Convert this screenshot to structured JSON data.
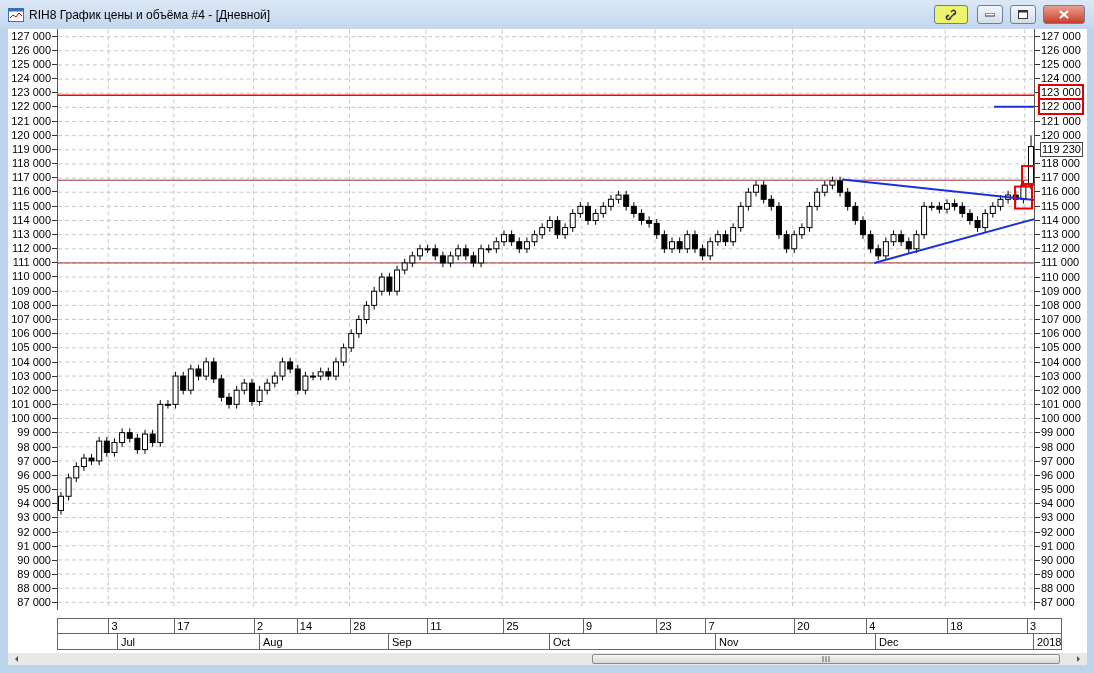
{
  "window": {
    "title": "RIH8 График цены и объёма #4 - [Дневной]"
  },
  "title_buttons": [
    {
      "kind": "link"
    },
    {
      "kind": "minimize"
    },
    {
      "kind": "maximize"
    },
    {
      "kind": "close"
    }
  ],
  "price_axis_right": {
    "labels": [
      {
        "text": "127 000",
        "kind": "tick"
      },
      {
        "text": "126 000",
        "kind": "tick"
      },
      {
        "text": "125 000",
        "kind": "tick"
      },
      {
        "text": "124 000",
        "kind": "tick"
      },
      {
        "text": "123 000",
        "kind": "marked"
      },
      {
        "text": "122 000",
        "kind": "marked"
      },
      {
        "text": "121 000",
        "kind": "tick"
      },
      {
        "text": "120 000",
        "kind": "tick"
      },
      {
        "text": "119 230",
        "kind": "last"
      },
      {
        "text": "118 000",
        "kind": "tick"
      },
      {
        "text": "117 000",
        "kind": "tick"
      },
      {
        "text": "116 000",
        "kind": "tick"
      },
      {
        "text": "115 000",
        "kind": "tick"
      },
      {
        "text": "114 000",
        "kind": "tick"
      },
      {
        "text": "113 000",
        "kind": "tick"
      },
      {
        "text": "112 000",
        "kind": "tick"
      },
      {
        "text": "111 000",
        "kind": "tick"
      },
      {
        "text": "110 000",
        "kind": "tick"
      },
      {
        "text": "109 000",
        "kind": "tick"
      },
      {
        "text": "108 000",
        "kind": "tick"
      },
      {
        "text": "107 000",
        "kind": "tick"
      },
      {
        "text": "106 000",
        "kind": "tick"
      },
      {
        "text": "105 000",
        "kind": "tick"
      },
      {
        "text": "104 000",
        "kind": "tick"
      },
      {
        "text": "103 000",
        "kind": "tick"
      },
      {
        "text": "102 000",
        "kind": "tick"
      },
      {
        "text": "101 000",
        "kind": "tick"
      },
      {
        "text": "100 000",
        "kind": "tick"
      },
      {
        "text": "99 000",
        "kind": "tick"
      },
      {
        "text": "98 000",
        "kind": "tick"
      },
      {
        "text": "97 000",
        "kind": "tick"
      },
      {
        "text": "96 000",
        "kind": "tick"
      },
      {
        "text": "95 000",
        "kind": "tick"
      },
      {
        "text": "94 000",
        "kind": "tick"
      },
      {
        "text": "93 000",
        "kind": "tick"
      },
      {
        "text": "92 000",
        "kind": "tick"
      },
      {
        "text": "91 000",
        "kind": "tick"
      },
      {
        "text": "90 000",
        "kind": "tick"
      },
      {
        "text": "89 000",
        "kind": "tick"
      },
      {
        "text": "88 000",
        "kind": "tick"
      },
      {
        "text": "87 000",
        "kind": "tick"
      }
    ]
  },
  "chart_data": {
    "type": "candlestick",
    "ylim": [
      86500,
      127500
    ],
    "grid": true,
    "ref_lines": [
      {
        "axis": "y",
        "value": 122850,
        "color": "#ff0000"
      },
      {
        "axis": "y",
        "value": 116850,
        "color": "#a03030"
      },
      {
        "axis": "y",
        "value": 111000,
        "color": "#a03030"
      }
    ],
    "yticks": [
      {
        "value": 127000,
        "label": "127 000"
      },
      {
        "value": 126000,
        "label": "126 000"
      },
      {
        "value": 125000,
        "label": "125 000"
      },
      {
        "value": 124000,
        "label": "124 000"
      },
      {
        "value": 123000,
        "label": "123 000"
      },
      {
        "value": 122000,
        "label": "122 000"
      },
      {
        "value": 121000,
        "label": "121 000"
      },
      {
        "value": 120000,
        "label": "120 000"
      },
      {
        "value": 119000,
        "label": "119 000"
      },
      {
        "value": 118000,
        "label": "118 000"
      },
      {
        "value": 117000,
        "label": "117 000"
      },
      {
        "value": 116000,
        "label": "116 000"
      },
      {
        "value": 115000,
        "label": "115 000"
      },
      {
        "value": 114000,
        "label": "114 000"
      },
      {
        "value": 113000,
        "label": "113 000"
      },
      {
        "value": 112000,
        "label": "112 000"
      },
      {
        "value": 111000,
        "label": "111 000"
      },
      {
        "value": 110000,
        "label": "110 000"
      },
      {
        "value": 109000,
        "label": "109 000"
      },
      {
        "value": 108000,
        "label": "108 000"
      },
      {
        "value": 107000,
        "label": "107 000"
      },
      {
        "value": 106000,
        "label": "106 000"
      },
      {
        "value": 105000,
        "label": "105 000"
      },
      {
        "value": 104000,
        "label": "104 000"
      },
      {
        "value": 103000,
        "label": "103 000"
      },
      {
        "value": 102000,
        "label": "102 000"
      },
      {
        "value": 101000,
        "label": "101 000"
      },
      {
        "value": 100000,
        "label": "100 000"
      },
      {
        "value": 99000,
        "label": "99 000"
      },
      {
        "value": 98000,
        "label": "98 000"
      },
      {
        "value": 97000,
        "label": "97 000"
      },
      {
        "value": 96000,
        "label": "96 000"
      },
      {
        "value": 95000,
        "label": "95 000"
      },
      {
        "value": 94000,
        "label": "94 000"
      },
      {
        "value": 93000,
        "label": "93 000"
      },
      {
        "value": 92000,
        "label": "92 000"
      },
      {
        "value": 91000,
        "label": "91 000"
      },
      {
        "value": 90000,
        "label": "90 000"
      },
      {
        "value": 89000,
        "label": "89 000"
      },
      {
        "value": 88000,
        "label": "88 000"
      },
      {
        "value": 87000,
        "label": "87 000"
      }
    ],
    "categories": [
      null,
      null,
      null,
      null,
      null,
      null,
      null,
      "3",
      null,
      null,
      null,
      null,
      null,
      null,
      null,
      null,
      "17",
      null,
      null,
      null,
      null,
      null,
      null,
      null,
      null,
      null,
      "2",
      null,
      null,
      null,
      null,
      null,
      "14",
      null,
      null,
      null,
      null,
      null,
      null,
      "28",
      null,
      null,
      null,
      null,
      null,
      null,
      null,
      null,
      null,
      "11",
      null,
      null,
      null,
      null,
      null,
      null,
      null,
      null,
      null,
      "25",
      null,
      null,
      null,
      null,
      null,
      null,
      null,
      null,
      null,
      "9",
      null,
      null,
      null,
      null,
      null,
      null,
      null,
      null,
      null,
      "23",
      null,
      null,
      null,
      null,
      null,
      "7",
      null,
      null,
      null,
      null,
      null,
      null,
      null,
      null,
      null,
      null,
      null,
      "20",
      null,
      null,
      null,
      null,
      null,
      null,
      null,
      null,
      "4",
      null,
      null,
      null,
      null,
      null,
      null,
      null,
      null,
      null,
      null,
      "18",
      null,
      null,
      null,
      null,
      null,
      null,
      null,
      null,
      null,
      "3"
    ],
    "ohlc": [
      [
        93500,
        94800,
        93200,
        94500
      ],
      [
        94500,
        96100,
        94200,
        95800
      ],
      [
        95800,
        96900,
        95500,
        96600
      ],
      [
        96600,
        97500,
        96300,
        97200
      ],
      [
        97200,
        97500,
        96700,
        97000
      ],
      [
        97000,
        98700,
        96700,
        98400
      ],
      [
        98400,
        98700,
        97300,
        97600
      ],
      [
        97600,
        98600,
        97300,
        98300
      ],
      [
        98300,
        99300,
        98000,
        99000
      ],
      [
        99000,
        99300,
        98300,
        98600
      ],
      [
        98600,
        98900,
        97500,
        97800
      ],
      [
        97800,
        99200,
        97500,
        98900
      ],
      [
        98900,
        99200,
        98000,
        98300
      ],
      [
        98300,
        101300,
        98000,
        101000
      ],
      [
        101000,
        101300,
        100700,
        101000
      ],
      [
        101000,
        103300,
        100700,
        103000
      ],
      [
        103000,
        103300,
        101700,
        102000
      ],
      [
        102000,
        103800,
        101700,
        103500
      ],
      [
        103500,
        103800,
        102700,
        103000
      ],
      [
        103000,
        104300,
        102700,
        104000
      ],
      [
        104000,
        104300,
        102500,
        102800
      ],
      [
        102800,
        103100,
        101200,
        101500
      ],
      [
        101500,
        101800,
        100700,
        101000
      ],
      [
        101000,
        102300,
        100700,
        102000
      ],
      [
        102000,
        102800,
        101700,
        102500
      ],
      [
        102500,
        102800,
        100900,
        101200
      ],
      [
        101200,
        102300,
        100900,
        102000
      ],
      [
        102000,
        102800,
        101700,
        102500
      ],
      [
        102500,
        103300,
        102200,
        103000
      ],
      [
        103000,
        104300,
        102700,
        104000
      ],
      [
        104000,
        104300,
        103200,
        103500
      ],
      [
        103500,
        103800,
        101700,
        102000
      ],
      [
        102000,
        103300,
        101700,
        103000
      ],
      [
        103000,
        103300,
        102700,
        103000
      ],
      [
        103000,
        103600,
        102700,
        103300
      ],
      [
        103300,
        103600,
        102700,
        103000
      ],
      [
        103000,
        104300,
        102700,
        104000
      ],
      [
        104000,
        105300,
        103700,
        105000
      ],
      [
        105000,
        106300,
        104700,
        106000
      ],
      [
        106000,
        107300,
        105700,
        107000
      ],
      [
        107000,
        108300,
        106700,
        108000
      ],
      [
        108000,
        109300,
        107700,
        109000
      ],
      [
        109000,
        110300,
        108700,
        110000
      ],
      [
        110000,
        110300,
        108700,
        109000
      ],
      [
        109000,
        110800,
        108700,
        110500
      ],
      [
        110500,
        111300,
        110200,
        111000
      ],
      [
        111000,
        111800,
        110700,
        111500
      ],
      [
        111500,
        112300,
        111200,
        112000
      ],
      [
        112000,
        112300,
        111700,
        112000
      ],
      [
        112000,
        112300,
        111200,
        111500
      ],
      [
        111500,
        111800,
        110700,
        111000
      ],
      [
        111000,
        111800,
        110700,
        111500
      ],
      [
        111500,
        112300,
        111200,
        112000
      ],
      [
        112000,
        112300,
        111200,
        111500
      ],
      [
        111500,
        111800,
        110700,
        111000
      ],
      [
        111000,
        112300,
        110700,
        112000
      ],
      [
        112000,
        112300,
        111700,
        112000
      ],
      [
        112000,
        112800,
        111700,
        112500
      ],
      [
        112500,
        113300,
        112200,
        113000
      ],
      [
        113000,
        113300,
        112200,
        112500
      ],
      [
        112500,
        112800,
        111700,
        112000
      ],
      [
        112000,
        112800,
        111700,
        112500
      ],
      [
        112500,
        113300,
        112200,
        113000
      ],
      [
        113000,
        113800,
        112700,
        113500
      ],
      [
        113500,
        114300,
        113200,
        114000
      ],
      [
        114000,
        114300,
        112700,
        113000
      ],
      [
        113000,
        113800,
        112700,
        113500
      ],
      [
        113500,
        114800,
        113200,
        114500
      ],
      [
        114500,
        115300,
        114200,
        115000
      ],
      [
        115000,
        115300,
        113700,
        114000
      ],
      [
        114000,
        114800,
        113700,
        114500
      ],
      [
        114500,
        115300,
        114200,
        115000
      ],
      [
        115000,
        115800,
        114700,
        115500
      ],
      [
        115500,
        116100,
        115200,
        115800
      ],
      [
        115800,
        116100,
        114700,
        115000
      ],
      [
        115000,
        115300,
        114200,
        114500
      ],
      [
        114500,
        114800,
        113700,
        114000
      ],
      [
        114000,
        114300,
        113500,
        113800
      ],
      [
        113800,
        114100,
        112700,
        113000
      ],
      [
        113000,
        113300,
        111700,
        112000
      ],
      [
        112000,
        112800,
        111700,
        112500
      ],
      [
        112500,
        112800,
        111700,
        112000
      ],
      [
        112000,
        113300,
        111700,
        113000
      ],
      [
        113000,
        113300,
        111700,
        112000
      ],
      [
        112000,
        112300,
        111200,
        111500
      ],
      [
        111500,
        112800,
        111200,
        112500
      ],
      [
        112500,
        113300,
        112200,
        113000
      ],
      [
        113000,
        113300,
        112200,
        112500
      ],
      [
        112500,
        113800,
        112200,
        113500
      ],
      [
        113500,
        115300,
        113200,
        115000
      ],
      [
        115000,
        116300,
        114700,
        116000
      ],
      [
        116000,
        116800,
        115700,
        116500
      ],
      [
        116500,
        116800,
        115200,
        115500
      ],
      [
        115500,
        115800,
        114700,
        115000
      ],
      [
        115000,
        115300,
        112700,
        113000
      ],
      [
        113000,
        113300,
        111700,
        112000
      ],
      [
        112000,
        113300,
        111700,
        113000
      ],
      [
        113000,
        113800,
        112700,
        113500
      ],
      [
        113500,
        115300,
        113200,
        115000
      ],
      [
        115000,
        116300,
        114700,
        116000
      ],
      [
        116000,
        116800,
        115700,
        116500
      ],
      [
        116500,
        117100,
        116200,
        116800
      ],
      [
        116800,
        117100,
        115700,
        116000
      ],
      [
        116000,
        116300,
        114700,
        115000
      ],
      [
        115000,
        115300,
        113700,
        114000
      ],
      [
        114000,
        114300,
        112700,
        113000
      ],
      [
        113000,
        113300,
        111700,
        112000
      ],
      [
        112000,
        112300,
        111200,
        111500
      ],
      [
        111500,
        112800,
        111200,
        112500
      ],
      [
        112500,
        113300,
        112200,
        113000
      ],
      [
        113000,
        113300,
        112200,
        112500
      ],
      [
        112500,
        112800,
        111700,
        112000
      ],
      [
        112000,
        113300,
        111700,
        113000
      ],
      [
        113000,
        115300,
        112700,
        115000
      ],
      [
        115000,
        115300,
        114700,
        115000
      ],
      [
        115000,
        115300,
        114500,
        114800
      ],
      [
        114800,
        115500,
        114500,
        115200
      ],
      [
        115200,
        115500,
        114700,
        115000
      ],
      [
        115000,
        115300,
        114200,
        114500
      ],
      [
        114500,
        114800,
        113700,
        114000
      ],
      [
        114000,
        114300,
        113200,
        113500
      ],
      [
        113500,
        114800,
        113200,
        114500
      ],
      [
        114500,
        115300,
        114200,
        115000
      ],
      [
        115000,
        115800,
        114700,
        115500
      ],
      [
        115500,
        116100,
        115200,
        115800
      ],
      [
        115800,
        116100,
        115200,
        115500
      ],
      [
        115500,
        116800,
        115200,
        116500
      ],
      [
        116500,
        120000,
        116200,
        119230
      ]
    ]
  },
  "date_axis": {
    "months": [
      "Jul",
      "Aug",
      "Sep",
      "Oct",
      "Nov",
      "Dec",
      "2018"
    ]
  }
}
